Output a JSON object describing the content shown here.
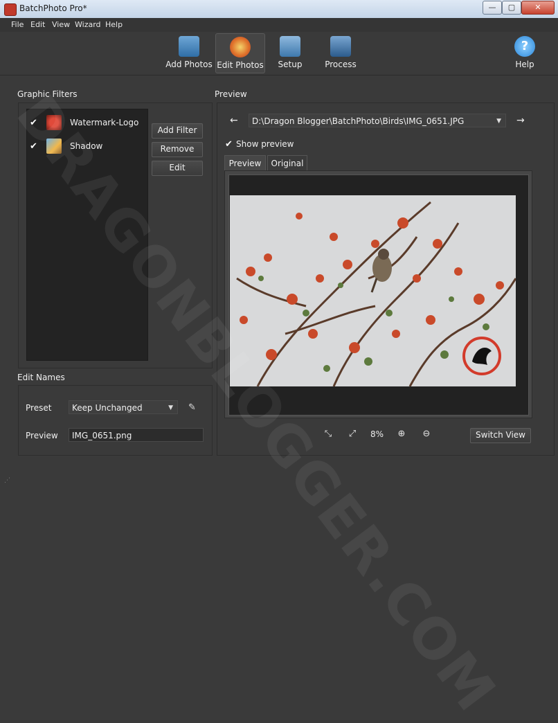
{
  "window": {
    "title": "BatchPhoto Pro*"
  },
  "window_controls": {
    "minimize": "—",
    "maximize": "▢",
    "close": "✕"
  },
  "menu": [
    "File",
    "Edit",
    "View",
    "Wizard",
    "Help"
  ],
  "toolbar": {
    "buttons": [
      {
        "label": "Add Photos",
        "icon": "camera-add-icon",
        "step": "1"
      },
      {
        "label": "Edit Photos",
        "icon": "palette-edit-icon",
        "step": "2"
      },
      {
        "label": "Setup",
        "icon": "camera-gear-icon",
        "step": "3"
      },
      {
        "label": "Process",
        "icon": "process-icon",
        "step": ""
      },
      {
        "label": "Help",
        "icon": "help-icon",
        "step": ""
      }
    ],
    "active": "Edit Photos"
  },
  "graphic_filters": {
    "title": "Graphic Filters",
    "items": [
      {
        "name": "Watermark-Logo",
        "checked": true,
        "icon": "watermark-logo-icon"
      },
      {
        "name": "Shadow",
        "checked": true,
        "icon": "shadow-icon"
      }
    ],
    "buttons": {
      "add": "Add Filter",
      "remove": "Remove",
      "edit": "Edit"
    }
  },
  "edit_names": {
    "title": "Edit Names",
    "preset_label": "Preset",
    "preset_value": "Keep Unchanged",
    "preview_label": "Preview",
    "preview_value": "IMG_0651.png"
  },
  "preview": {
    "title": "Preview",
    "path": "D:\\Dragon Blogger\\BatchPhoto\\Birds\\IMG_0651.JPG",
    "show_preview_label": "Show preview",
    "show_preview_checked": true,
    "tabs": [
      "Preview",
      "Original"
    ],
    "active_tab": "Preview",
    "zoom": "8%",
    "switch_view": "Switch View"
  },
  "watermark_text": "DRAGONBLOGGER.COM",
  "colors": {
    "background": "#3a3a3a",
    "list_bg": "#232323",
    "accent_red": "#d23b2b"
  }
}
